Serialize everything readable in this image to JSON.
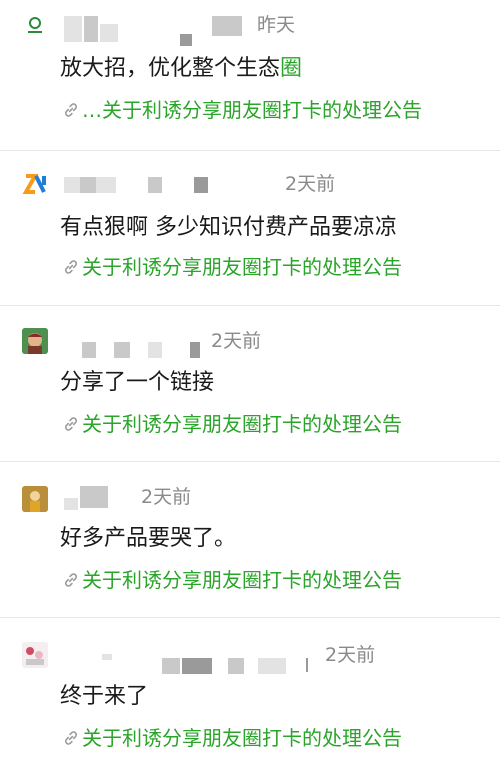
{
  "posts": [
    {
      "time": "昨天",
      "content_main": "放大招，优化整个生态",
      "content_highlight": "圈",
      "link_prefix": "…",
      "link_text": "关于利诱分享朋友圈打卡的处理公告"
    },
    {
      "time": "2天前",
      "content_main": "有点狠啊 多少知识付费产品要凉凉",
      "link_text": "关于利诱分享朋友圈打卡的处理公告"
    },
    {
      "time": "2天前",
      "content_main": "分享了一个链接",
      "link_text": "关于利诱分享朋友圈打卡的处理公告"
    },
    {
      "time": "2天前",
      "content_main": "好多产品要哭了。",
      "link_text": "关于利诱分享朋友圈打卡的处理公告"
    },
    {
      "time": "2天前",
      "content_main": "终于来了",
      "link_text": "关于利诱分享朋友圈打卡的处理公告"
    }
  ],
  "colors": {
    "link_green": "#2aa52a",
    "time_gray": "#8a8a8a"
  },
  "icons": [
    "link-chain-icon"
  ]
}
